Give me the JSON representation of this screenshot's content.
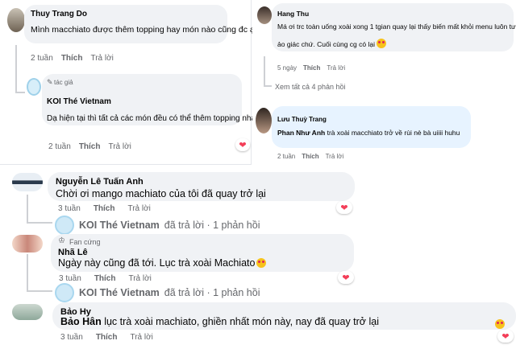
{
  "panel_left": {
    "comment1": {
      "name": "Thuy Trang Do",
      "text": "Mình macchiato được thêm topping hay món nào cũng đc ạ?",
      "time": "2 tuần",
      "like": "Thích",
      "reply": "Trả lời"
    },
    "comment2": {
      "author_badge": "tác giả",
      "name": "KOI Thé Vietnam",
      "text": "Dạ hiện tại thì tất cả các món đều có thể thêm topping nha ạ",
      "time": "2 tuần",
      "like": "Thích",
      "reply": "Trả lời"
    }
  },
  "panel_right": {
    "comment1": {
      "name": "Hang Thu",
      "text_line1": "Má ơi trc toàn uống xoài xong 1 tgian quay lại thấy biến mất khỏi menu luôn tưởng bị",
      "text_line2": "ảo giác chứ. Cuối cùng cg có lại",
      "time": "5 ngày",
      "like": "Thích",
      "reply": "Trả lời",
      "view_all": "Xem tất cả 4 phản hồi"
    },
    "comment2": {
      "name": "Lưu Thuỳ Trang",
      "mention": "Phan Như Anh",
      "text": "trà xoài macchiato trở về rùi nè bà uiiii huhu",
      "time": "2 tuần",
      "like": "Thích",
      "reply": "Trả lời"
    }
  },
  "lower": {
    "comment1": {
      "name": "Nguyễn Lê Tuấn Anh",
      "text": "Chời ơi mango machiato của tôi đã quay trở lại",
      "time": "3 tuần",
      "like": "Thích",
      "reply": "Trả lời",
      "reply_summary_name": "KOI Thé Vietnam",
      "reply_summary_rest": "đã trả lời · 1 phản hồi"
    },
    "comment2": {
      "fan_badge": "Fan cứng",
      "name": "Nhã Lê",
      "text": "Ngày này cũng đã tới. Lục trà xoài Machiato",
      "time": "3 tuần",
      "like": "Thích",
      "reply": "Trả lời",
      "reply_summary_name": "KOI Thé Vietnam",
      "reply_summary_rest": "đã trả lời · 1 phản hồi"
    },
    "comment3": {
      "name": "Bảo Hy",
      "mention": "Bảo Hân",
      "text": "lục trà xoài machiato, ghiền nhất món này, nay đã quay trở lại",
      "time": "3 tuần",
      "like": "Thích",
      "reply": "Trả lời"
    }
  },
  "colors": {
    "bubble": "#f0f2f5",
    "bubble_highlight": "#e7f3ff",
    "meta_text": "#65676b",
    "heart": "#f33e58",
    "link": "#216fdb"
  }
}
